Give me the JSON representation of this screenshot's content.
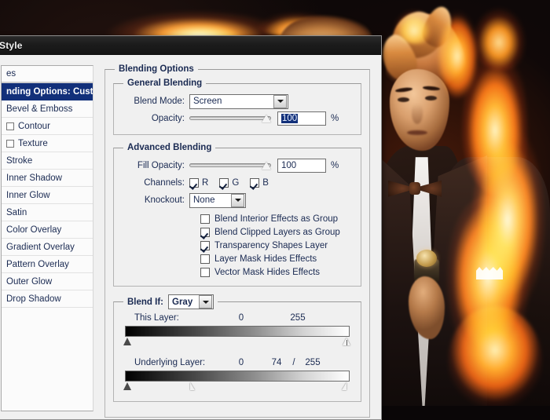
{
  "background": {
    "description": "photo of a blond man in a black tuxedo with bow tie and pocket square, engulfed in orange flames on a dark background"
  },
  "dialog": {
    "title": "Style",
    "styles_list": [
      {
        "label": "es",
        "selected": false,
        "checkbox": null
      },
      {
        "label": "nding Options: Custom",
        "selected": true,
        "checkbox": null
      },
      {
        "label": "Bevel & Emboss",
        "selected": false,
        "checkbox": null
      },
      {
        "label": "Contour",
        "selected": false,
        "checkbox": false
      },
      {
        "label": "Texture",
        "selected": false,
        "checkbox": false
      },
      {
        "label": "Stroke",
        "selected": false,
        "checkbox": null
      },
      {
        "label": "Inner Shadow",
        "selected": false,
        "checkbox": null
      },
      {
        "label": "Inner Glow",
        "selected": false,
        "checkbox": null
      },
      {
        "label": "Satin",
        "selected": false,
        "checkbox": null
      },
      {
        "label": "Color Overlay",
        "selected": false,
        "checkbox": null
      },
      {
        "label": "Gradient Overlay",
        "selected": false,
        "checkbox": null
      },
      {
        "label": "Pattern Overlay",
        "selected": false,
        "checkbox": null
      },
      {
        "label": "Outer Glow",
        "selected": false,
        "checkbox": null
      },
      {
        "label": "Drop Shadow",
        "selected": false,
        "checkbox": null
      }
    ],
    "blending_options": {
      "group_label": "Blending Options",
      "general": {
        "group_label": "General Blending",
        "blend_mode_label": "Blend Mode:",
        "blend_mode_value": "Screen",
        "opacity_label": "Opacity:",
        "opacity_value": "100",
        "opacity_unit": "%",
        "opacity_slider_pct": 100
      },
      "advanced": {
        "group_label": "Advanced Blending",
        "fill_opacity_label": "Fill Opacity:",
        "fill_opacity_value": "100",
        "fill_opacity_unit": "%",
        "fill_opacity_slider_pct": 100,
        "channels_label": "Channels:",
        "channels": [
          {
            "label": "R",
            "checked": true
          },
          {
            "label": "G",
            "checked": true
          },
          {
            "label": "B",
            "checked": true
          }
        ],
        "knockout_label": "Knockout:",
        "knockout_value": "None",
        "options": [
          {
            "label": "Blend Interior Effects as Group",
            "checked": false
          },
          {
            "label": "Blend Clipped Layers as Group",
            "checked": true
          },
          {
            "label": "Transparency Shapes Layer",
            "checked": true
          },
          {
            "label": "Layer Mask Hides Effects",
            "checked": false
          },
          {
            "label": "Vector Mask Hides Effects",
            "checked": false
          }
        ]
      },
      "blend_if": {
        "label": "Blend If:",
        "value": "Gray",
        "this_layer": {
          "label": "This Layer:",
          "low": "0",
          "high": "255",
          "low_pct": 0,
          "high_pct": 100
        },
        "underlying_layer": {
          "label": "Underlying Layer:",
          "low": "0",
          "mid": "74",
          "separator": "/",
          "high": "255",
          "low_pct": 0,
          "mid_pct": 29,
          "high_pct": 100
        }
      }
    },
    "colors": {
      "selection": "#12307a",
      "label_text": "#1a2a52",
      "dialog_bg": "#f0f0f0",
      "titlebar_bg": "#1c1c1c"
    }
  }
}
